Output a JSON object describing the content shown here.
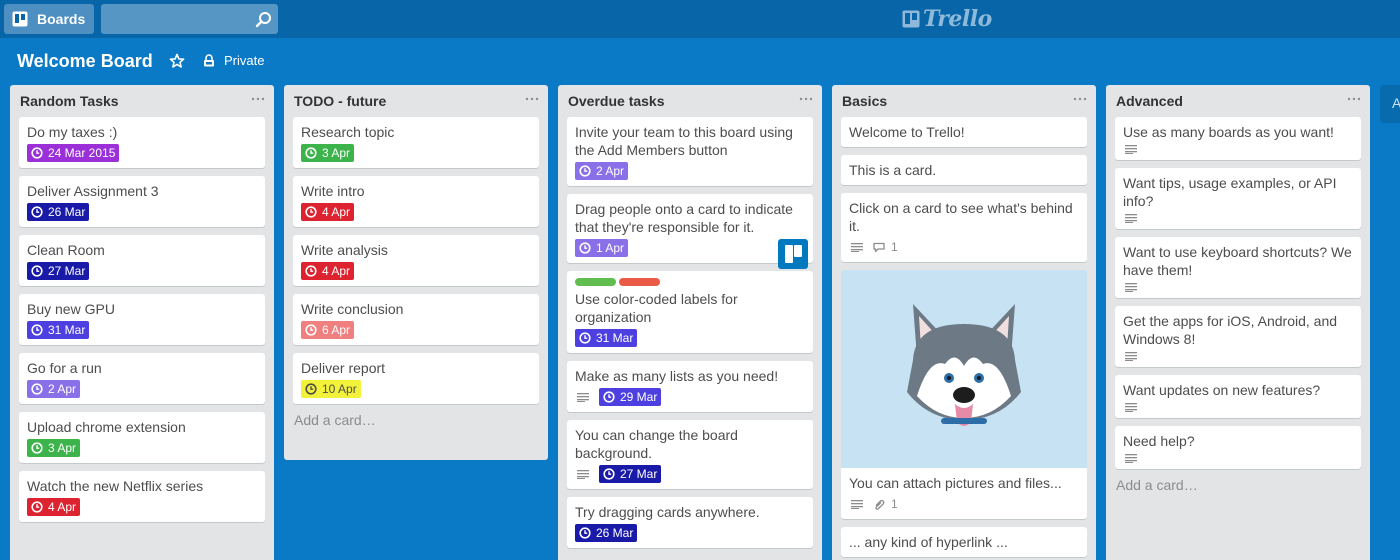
{
  "topbar": {
    "boards_label": "Boards",
    "search": {
      "value": "",
      "placeholder": ""
    },
    "logo_text": "Trello"
  },
  "board": {
    "title": "Welcome Board",
    "visibility_label": "Private"
  },
  "icons": {
    "boards": "boards-icon",
    "search": "search-icon",
    "star": "star-icon",
    "lock": "lock-icon",
    "clock": "clock-icon",
    "description": "description-icon",
    "comment": "comment-icon",
    "attachment": "paperclip-icon",
    "list_menu": "ellipsis-icon"
  },
  "colors": {
    "board_bg": "#0a7ac6",
    "topbar_bg": "#0765a8",
    "purple": "#9b30d9",
    "navy": "#1a1aa8",
    "indigo": "#4d3fe0",
    "lavender": "#8a70e8",
    "green": "#3cb44b",
    "red": "#dd2230",
    "salmon": "#f0807f",
    "yellow": "#f2f23a",
    "label_green": "#61bd4f",
    "label_red": "#eb5a46"
  },
  "lists": [
    {
      "title": "Random Tasks",
      "cards": [
        {
          "title": "Do my taxes :)",
          "due": "24 Mar 2015",
          "due_color": "purple"
        },
        {
          "title": "Deliver Assignment 3",
          "due": "26 Mar",
          "due_color": "navy"
        },
        {
          "title": "Clean Room",
          "due": "27 Mar",
          "due_color": "navy"
        },
        {
          "title": "Buy new GPU",
          "due": "31 Mar",
          "due_color": "indigo"
        },
        {
          "title": "Go for a run",
          "due": "2 Apr",
          "due_color": "lavender"
        },
        {
          "title": "Upload chrome extension",
          "due": "3 Apr",
          "due_color": "green"
        },
        {
          "title": "Watch the new Netflix series",
          "due": "4 Apr",
          "due_color": "red"
        }
      ]
    },
    {
      "title": "TODO - future",
      "cards": [
        {
          "title": "Research topic",
          "due": "3 Apr",
          "due_color": "green"
        },
        {
          "title": "Write intro",
          "due": "4 Apr",
          "due_color": "red"
        },
        {
          "title": "Write analysis",
          "due": "4 Apr",
          "due_color": "red"
        },
        {
          "title": "Write conclusion",
          "due": "6 Apr",
          "due_color": "salmon"
        },
        {
          "title": "Deliver report",
          "due": "10 Apr",
          "due_color": "yellow"
        }
      ],
      "add_card": "Add a card…"
    },
    {
      "title": "Overdue tasks",
      "cards": [
        {
          "title": "Invite your team to this board using the Add Members button",
          "due": "2 Apr",
          "due_color": "lavender"
        },
        {
          "title": "Drag people onto a card to indicate that they're responsible for it.",
          "due": "1 Apr",
          "due_color": "lavender"
        },
        {
          "title": "Use color-coded labels for organization",
          "due": "31 Mar",
          "due_color": "indigo"
        },
        {
          "title": "Make as many lists as you need!",
          "due": "29 Mar",
          "due_color": "indigo"
        },
        {
          "title": "You can change the board background.",
          "due": "27 Mar",
          "due_color": "navy"
        },
        {
          "title": "Try dragging cards anywhere.",
          "due": "26 Mar",
          "due_color": "navy"
        }
      ]
    },
    {
      "title": "Basics",
      "cards": [
        {
          "title": "Welcome to Trello!"
        },
        {
          "title": "This is a card."
        },
        {
          "title": "Click on a card to see what's behind it.",
          "comments": "1"
        },
        {
          "title": "You can attach pictures and files...",
          "attachments": "1"
        },
        {
          "title": "... any kind of hyperlink ..."
        }
      ]
    },
    {
      "title": "Advanced",
      "cards": [
        {
          "title": "Use as many boards as you want!"
        },
        {
          "title": "Want tips, usage examples, or API info?"
        },
        {
          "title": "Want to use keyboard shortcuts? We have them!"
        },
        {
          "title": "Get the apps for iOS, Android, and Windows 8!"
        },
        {
          "title": "Want updates on new features?"
        },
        {
          "title": "Need help?"
        }
      ],
      "add_card": "Add a card…"
    }
  ],
  "peek_list": {
    "title": "A"
  }
}
